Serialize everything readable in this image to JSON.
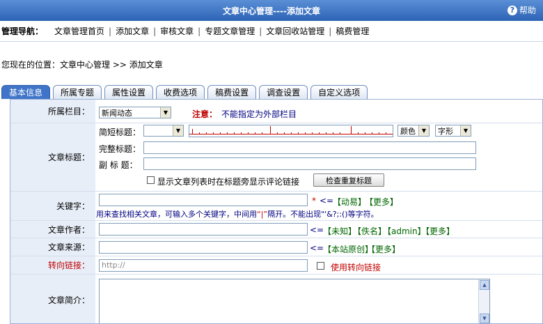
{
  "header": {
    "title": "文章中心管理----添加文章",
    "help_label": "帮助"
  },
  "nav": {
    "label": "管理导航：",
    "items": [
      "文章管理首页",
      "添加文章",
      "审核文章",
      "专题文章管理",
      "文章回收站管理",
      "稿费管理"
    ]
  },
  "location": "您现在的位置：文章中心管理 >> 添加文章",
  "tabs": [
    "基本信息",
    "所属专题",
    "属性设置",
    "收费选项",
    "稿费设置",
    "调查设置",
    "自定义选项"
  ],
  "form": {
    "category": {
      "label": "所属栏目：",
      "selected": "新闻动态",
      "note_prefix": "注意：",
      "note_text": "不能指定为外部栏目"
    },
    "title": {
      "label": "文章标题：",
      "short_label": "简短标题：",
      "color_select": "颜色",
      "font_select": "字形",
      "full_label": "完整标题：",
      "sub_label": "副 标 题：",
      "show_comment_link": "显示文章列表时在标题旁显示评论链接",
      "check_dup_button": "检查重复标题"
    },
    "keywords": {
      "label": "关键字：",
      "required": "*",
      "arrow": "<=",
      "links": [
        "【动易】",
        "【更多】"
      ],
      "hint_prefix": "用来查找相关文章，可输入多个关键字，中间用",
      "hint_sep": "“|”",
      "hint_suffix": "隔开。不能出现\"'&?;:()等字符。"
    },
    "author": {
      "label": "文章作者：",
      "arrow": "<=",
      "links": [
        "【未知】",
        "【佚名】",
        "【admin】",
        "【更多】"
      ]
    },
    "source": {
      "label": "文章来源：",
      "arrow": "<=",
      "links": [
        "【本站原创】",
        "【更多】"
      ]
    },
    "redirect": {
      "label": "转向链接：",
      "placeholder": "http://",
      "checkbox_label": "使用转向链接"
    },
    "intro": {
      "label": "文章简介："
    }
  }
}
